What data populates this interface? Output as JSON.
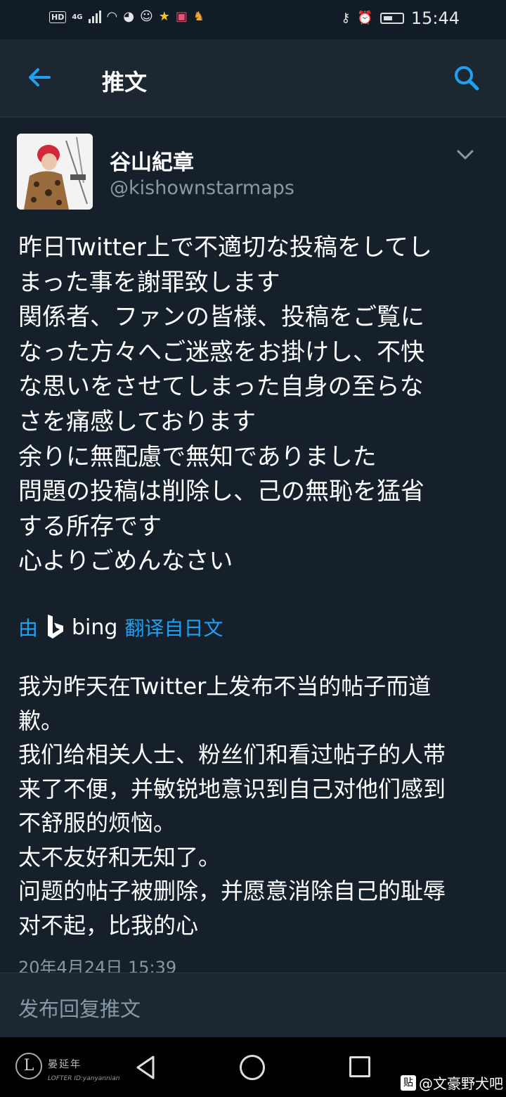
{
  "status_bar": {
    "network": "4G",
    "hd": "HD",
    "time": "15:44"
  },
  "header": {
    "title": "推文"
  },
  "tweet": {
    "author_name": "谷山紀章",
    "author_handle": "@kishownstarmaps",
    "lines": [
      "昨日Twitter上で不適切な投稿をしてし",
      "まった事を謝罪致します",
      "関係者、ファンの皆様、投稿をご覧に",
      "なった方々へご迷惑をお掛けし、不快",
      "な思いをさせてしまった自身の至らな",
      "さを痛感しております",
      "余りに無配慮で無知でありました",
      "問題の投稿は削除し、己の無恥を猛省",
      "する所存です",
      "心よりごめんなさい"
    ],
    "translation_prefix": "由",
    "translation_provider": "bing",
    "translation_suffix": "翻译自日文",
    "translated_lines": [
      "我为昨天在Twitter上发布不当的帖子而道",
      "歉。",
      "我们给相关人士、粉丝们和看过帖子的人带",
      "来了不便，并敏锐地意识到自己对他们感到",
      "不舒服的烦恼。",
      "太不友好和无知了。",
      "问题的帖子被删除，并愿意消除自己的耻辱",
      "对不起，比我的心"
    ],
    "timestamp": "20年4月24日 15:39"
  },
  "reply": {
    "placeholder": "发布回复推文"
  },
  "watermarks": {
    "lofter_name": "晏延年",
    "lofter_id": "LOFTER ID:yanyannian",
    "tieba_badge": "贴",
    "tieba_name": "@文豪野犬吧"
  },
  "colors": {
    "background": "#15202b",
    "header": "#1c2732",
    "accent": "#1da1f2",
    "secondary_text": "#8899a6"
  }
}
